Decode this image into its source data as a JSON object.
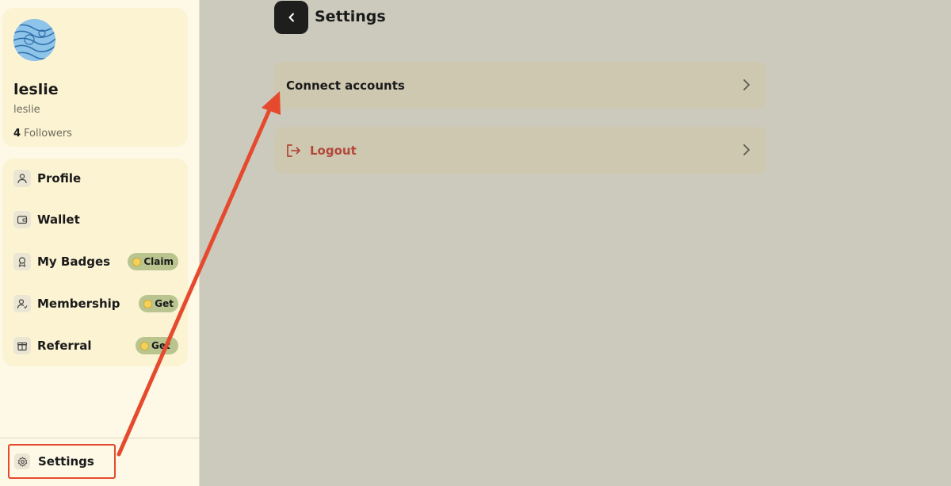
{
  "sidebar": {
    "profile": {
      "name": "leslie",
      "handle": "leslie",
      "followers_count": "4",
      "followers_label": "Followers"
    },
    "nav": [
      {
        "label": "Profile",
        "icon": "person-icon"
      },
      {
        "label": "Wallet",
        "icon": "wallet-icon"
      },
      {
        "label": "My Badges",
        "icon": "badge-icon",
        "pill": "Claim"
      },
      {
        "label": "Membership",
        "icon": "membership-icon",
        "pill": "Get"
      },
      {
        "label": "Referral",
        "icon": "gift-icon",
        "pill": "Get"
      }
    ],
    "settings_label": "Settings"
  },
  "main": {
    "title": "Settings",
    "rows": [
      {
        "label": "Connect accounts"
      },
      {
        "label": "Logout"
      }
    ]
  },
  "colors": {
    "sidebar_bg": "#fdf9e6",
    "card_bg": "#fbf3d2",
    "main_bg": "#cbcabd",
    "row_bg": "#cec8b1",
    "pill_bg": "#b9c48f",
    "logout": "#b3473a",
    "annotation": "#e64a2e"
  }
}
